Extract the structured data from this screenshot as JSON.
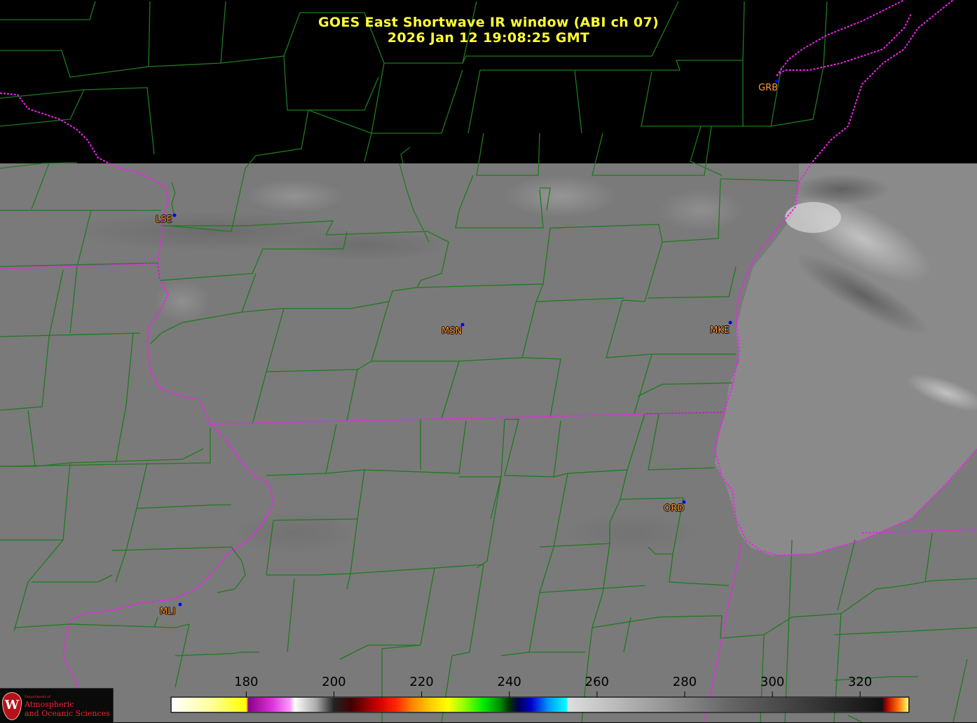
{
  "title": {
    "line1": "GOES East Shortwave IR window (ABI ch 07)",
    "line2": "2026 Jan 12  19:08:25 GMT"
  },
  "stations": [
    {
      "id": "LSE",
      "label": "LSE"
    },
    {
      "id": "MSN",
      "label": "MSN"
    },
    {
      "id": "MKE",
      "label": "MKE"
    },
    {
      "id": "GRB",
      "label": "GRB"
    },
    {
      "id": "ORD",
      "label": "ORD"
    },
    {
      "id": "MLI",
      "label": "MLI"
    }
  ],
  "colorbar": {
    "unit_range": [
      163,
      331
    ],
    "ticks": [
      "180",
      "200",
      "220",
      "240",
      "260",
      "280",
      "300",
      "320"
    ]
  },
  "logo": {
    "small_text": "Department of",
    "line1": "Atmospheric",
    "line2": "and Oceanic Sciences",
    "crest_letter": "W"
  },
  "colors": {
    "title": "#ffff33",
    "county_lines": "#1e7a1e",
    "state_lines": "#ee22ee",
    "station_label": "#ff9a3c",
    "station_dot": "#0000ff",
    "land_gray": "#7a7a7a",
    "lake_gray": "#8c8c8c"
  }
}
